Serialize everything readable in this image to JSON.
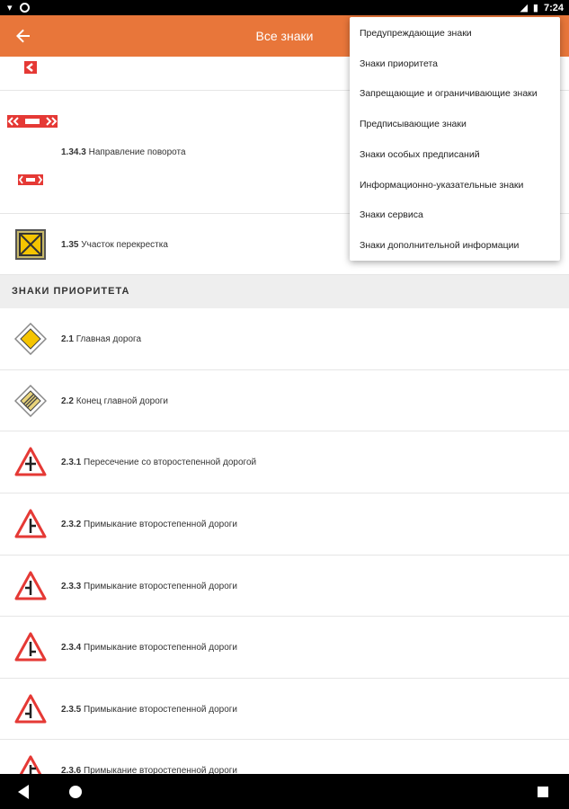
{
  "status": {
    "time": "7:24"
  },
  "appbar": {
    "title": "Все знаки"
  },
  "menu": {
    "items": [
      "Предупреждающие знаки",
      "Знаки приоритета",
      "Запрещающие и ограничивающие знаки",
      "Предписывающие знаки",
      "Знаки особых предписаний",
      "Информационно-указательные знаки",
      "Знаки сервиса",
      "Знаки дополнительной информации"
    ]
  },
  "list": {
    "warning_rows": [
      {
        "code": "1.34.3",
        "name": "Направление поворота"
      },
      {
        "code": "1.35",
        "name": "Участок перекрестка"
      }
    ],
    "section_priority": "ЗНАКИ ПРИОРИТЕТА",
    "priority_rows": [
      {
        "code": "2.1",
        "name": "Главная дорога"
      },
      {
        "code": "2.2",
        "name": "Конец главной дороги"
      },
      {
        "code": "2.3.1",
        "name": "Пересечение со второстепенной дорогой"
      },
      {
        "code": "2.3.2",
        "name": "Примыкание второстепенной дороги"
      },
      {
        "code": "2.3.3",
        "name": "Примыкание второстепенной дороги"
      },
      {
        "code": "2.3.4",
        "name": "Примыкание второстепенной дороги"
      },
      {
        "code": "2.3.5",
        "name": "Примыкание второстепенной дороги"
      },
      {
        "code": "2.3.6",
        "name": "Примыкание второстепенной дороги"
      }
    ]
  },
  "colors": {
    "accent": "#e8763a",
    "sign_red": "#e53935",
    "sign_yellow": "#f5c400"
  }
}
